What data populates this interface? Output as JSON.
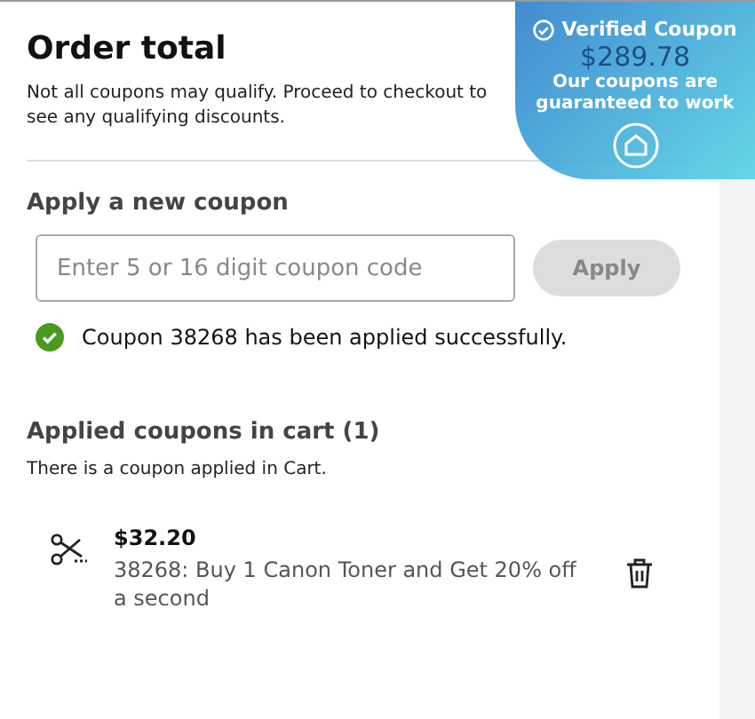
{
  "header": {
    "title": "Order total",
    "note": "Not all coupons may qualify. Proceed to checkout to see any qualifying discounts.",
    "total": "$289.78"
  },
  "badge": {
    "title": "Verified Coupon",
    "tagline": "Our coupons are guaranteed to work"
  },
  "apply": {
    "heading": "Apply a new coupon",
    "placeholder": "Enter 5 or 16 digit coupon code",
    "button": "Apply",
    "button_disabled": true,
    "message": "Coupon 38268 has been applied successfully."
  },
  "applied": {
    "heading": "Applied coupons in cart (1)",
    "note": "There is a coupon applied in Cart.",
    "coupons": [
      {
        "amount": "$32.20",
        "description": "38268: Buy 1 Canon Toner and Get 20% off a second"
      }
    ]
  }
}
